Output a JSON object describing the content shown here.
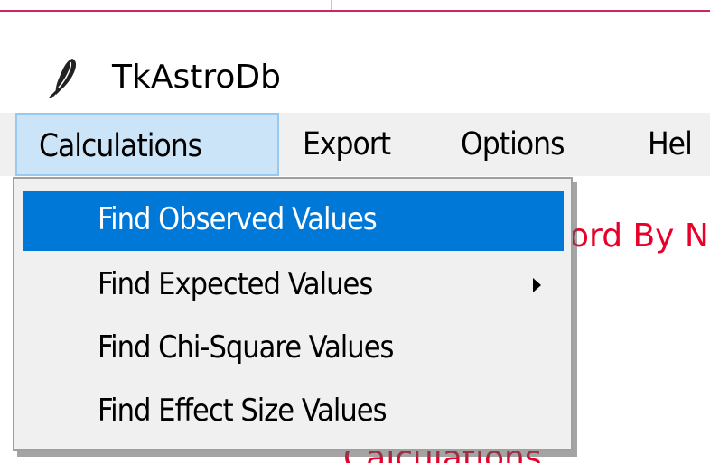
{
  "window": {
    "title": "TkAstroDb",
    "icon": "feather-icon"
  },
  "menubar": {
    "items": [
      {
        "label": "Calculations",
        "active": true
      },
      {
        "label": "Export",
        "active": false
      },
      {
        "label": "Options",
        "active": false
      },
      {
        "label": "Hel",
        "active": false
      }
    ]
  },
  "dropdown": {
    "items": [
      {
        "label": "Find Observed Values",
        "highlighted": true,
        "submenu": false
      },
      {
        "label": "Find Expected Values",
        "highlighted": false,
        "submenu": true
      },
      {
        "label": "Find Chi-Square Values",
        "highlighted": false,
        "submenu": false
      },
      {
        "label": "Find Effect Size Values",
        "highlighted": false,
        "submenu": false
      }
    ]
  },
  "content": {
    "partial_text_1": "ord By N",
    "partial_text_2": "Calculations."
  },
  "colors": {
    "accent": "#0078d7",
    "menu_active_bg": "#cce4f7",
    "content_text": "#e8002a",
    "frame_accent": "#c8285a"
  }
}
